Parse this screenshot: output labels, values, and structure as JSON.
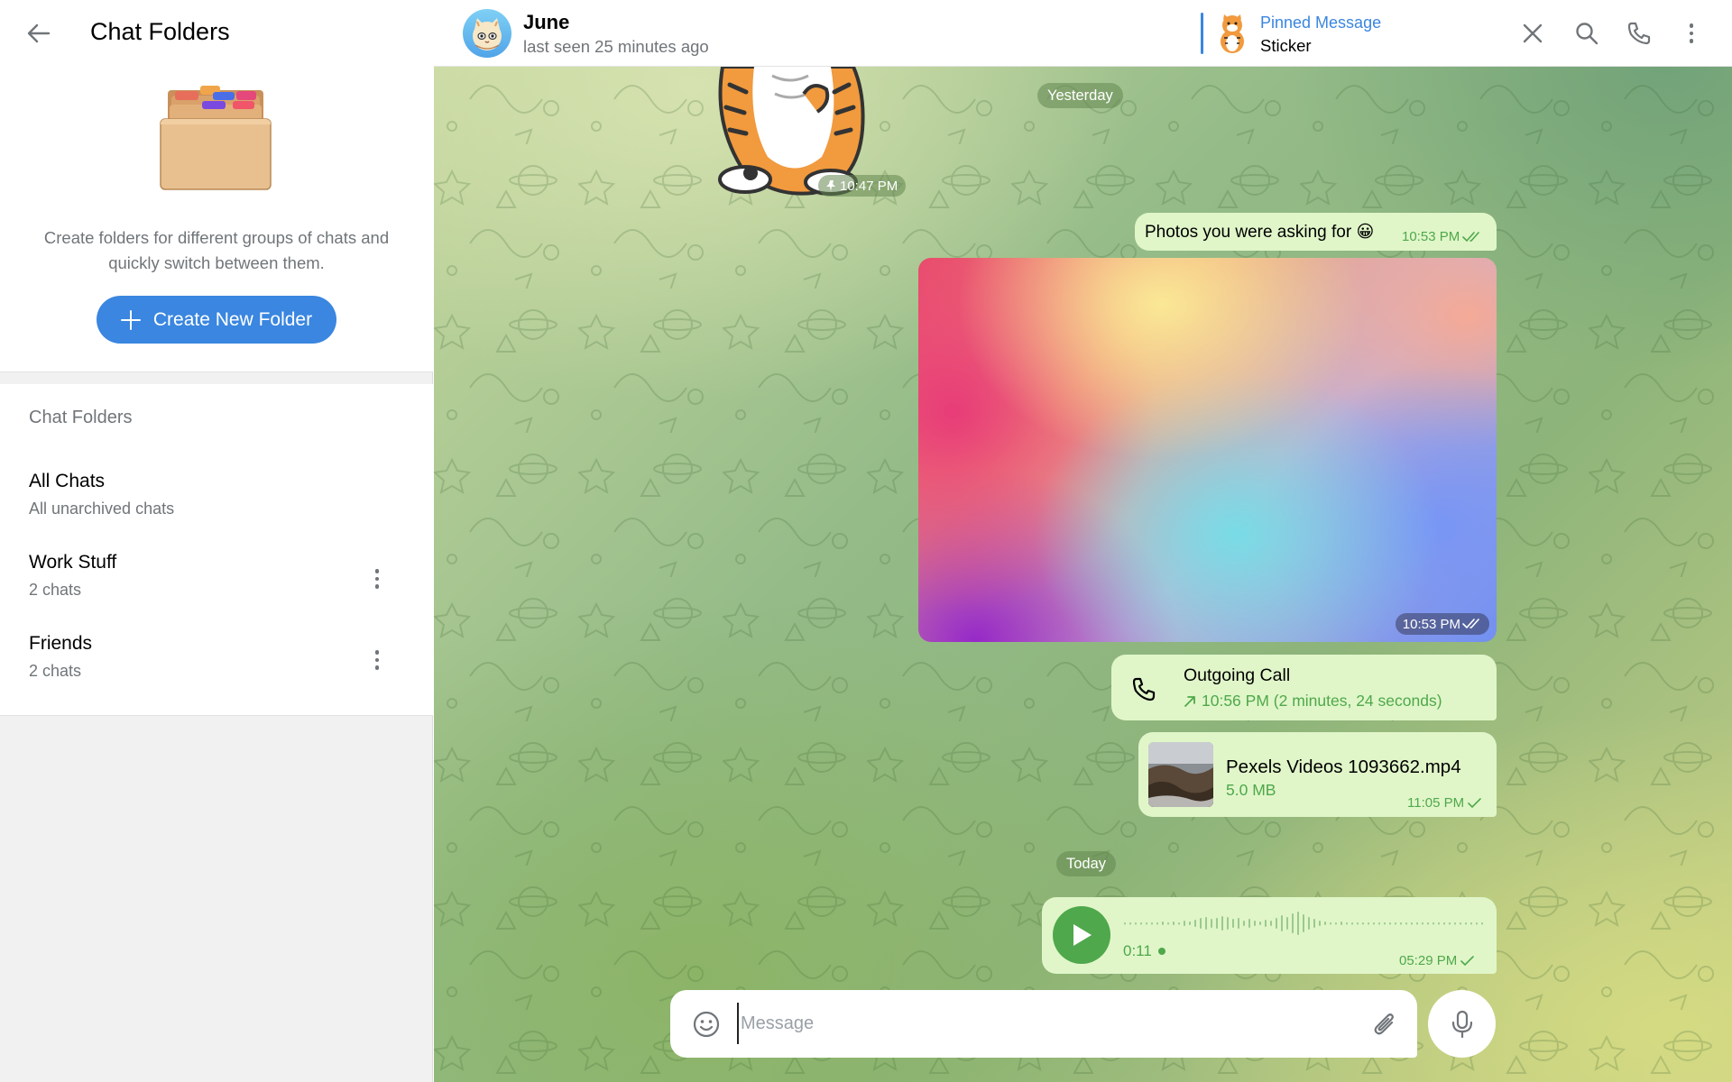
{
  "left_panel": {
    "title": "Chat Folders",
    "description": "Create folders for different groups of chats and quickly switch between them.",
    "create_button": "Create New Folder",
    "section_heading": "Chat Folders",
    "folders": [
      {
        "name": "All Chats",
        "subtitle": "All unarchived chats",
        "has_menu": false
      },
      {
        "name": "Work Stuff",
        "subtitle": "2 chats",
        "has_menu": true
      },
      {
        "name": "Friends",
        "subtitle": "2 chats",
        "has_menu": true
      }
    ]
  },
  "chat_header": {
    "peer_name": "June",
    "peer_status": "last seen 25 minutes ago",
    "pinned_title": "Pinned Message",
    "pinned_text": "Sticker"
  },
  "messages": {
    "date_yesterday": "Yesterday",
    "sticker_time": "10:47 PM",
    "text_message": {
      "text": "Photos you were asking for",
      "emoji": "😀",
      "time": "10:53 PM"
    },
    "photo_time": "10:53 PM",
    "call": {
      "title": "Outgoing Call",
      "detail": "10:56 PM (2 minutes, 24 seconds)"
    },
    "file": {
      "name": "Pexels Videos 1093662.mp4",
      "size": "5.0 MB",
      "time": "11:05 PM"
    },
    "date_today": "Today",
    "voice": {
      "duration": "0:11",
      "time": "05:29 PM"
    }
  },
  "composer": {
    "placeholder": "Message"
  },
  "icons": {
    "back": "arrow-left-icon",
    "close": "close-icon",
    "search": "search-icon",
    "phone": "phone-icon",
    "more": "more-vertical-icon",
    "emoji": "smile-icon",
    "attach": "paperclip-icon",
    "mic": "microphone-icon",
    "play": "play-icon"
  },
  "colors": {
    "accent": "#3a86e0",
    "bubble_out": "#e0f6c9",
    "bubble_meta": "#4fa84b",
    "secondary_text": "#707579"
  }
}
